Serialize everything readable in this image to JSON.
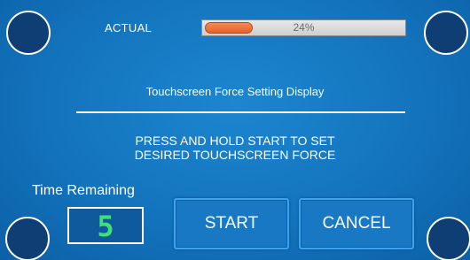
{
  "header": {
    "actual_label": "ACTUAL",
    "progress_percent": 24,
    "progress_text": "24%"
  },
  "main": {
    "title": "Touchscreen Force Setting Display",
    "instruction_line1": "PRESS AND HOLD START TO SET",
    "instruction_line2": "DESIRED TOUCHSCREEN FORCE"
  },
  "timer": {
    "label": "Time Remaining",
    "value": "5"
  },
  "buttons": {
    "start_label": "START",
    "cancel_label": "CANCEL"
  },
  "colors": {
    "background": "#1374bd",
    "progress_fill": "#e5622e",
    "digit": "#3fe07a"
  }
}
